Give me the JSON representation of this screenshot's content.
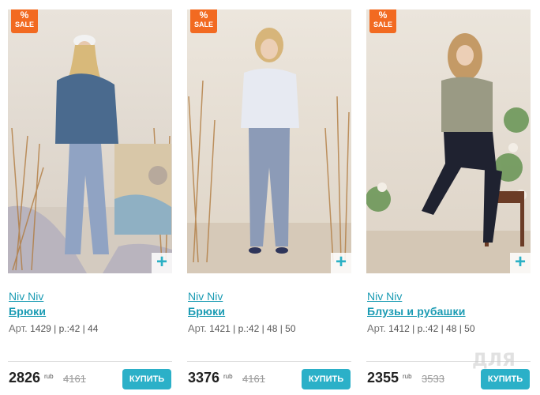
{
  "products": [
    {
      "sale_pct": "%",
      "sale_text": "SALE",
      "brand": "Niv Niv",
      "name": "Брюки",
      "sku_label": "Арт.",
      "sku_text": "1429 | р.:42 | 44",
      "price": "2826",
      "currency": "rub",
      "old_price": "4161",
      "buy_label": "КУПИТЬ"
    },
    {
      "sale_pct": "%",
      "sale_text": "SALE",
      "brand": "Niv Niv",
      "name": "Брюки",
      "sku_label": "Арт.",
      "sku_text": "1421 | р.:42 | 48 | 50",
      "price": "3376",
      "currency": "rub",
      "old_price": "4161",
      "buy_label": "КУПИТЬ"
    },
    {
      "sale_pct": "%",
      "sale_text": "SALE",
      "brand": "Niv Niv",
      "name": "Блузы и рубашки",
      "sku_label": "Арт.",
      "sku_text": "1412 | р.:42 | 48 | 50",
      "price": "2355",
      "currency": "rub",
      "old_price": "3533",
      "buy_label": "КУПИТЬ"
    }
  ],
  "plus_glyph": "+",
  "watermark": "ДЛЯ",
  "colors": {
    "accent": "#2bb0c8",
    "link": "#1a9bb3",
    "sale": "#f26a21"
  }
}
